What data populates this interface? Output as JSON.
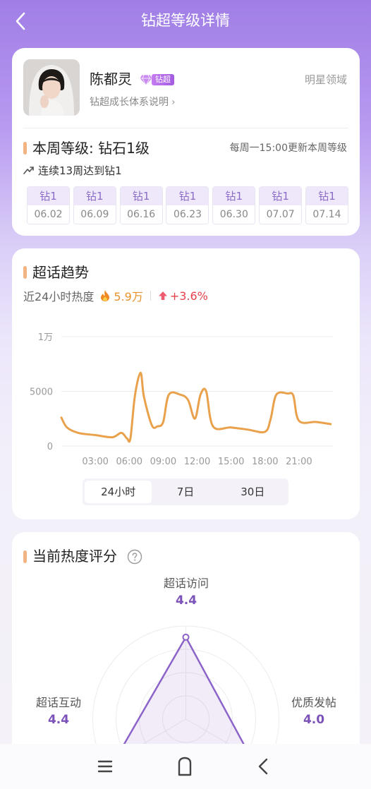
{
  "header": {
    "title": "钻超等级详情",
    "back_icon": "chevron-left-icon"
  },
  "profile": {
    "name": "陈都灵",
    "badge_label": "钻超",
    "growth_link": "钻超成长体系说明",
    "field": "明星领域"
  },
  "level": {
    "title": "本周等级: 钻石1级",
    "update_note": "每周一15:00更新本周等级",
    "streak": "连续13周达到钻1",
    "weeks": [
      {
        "level": "钻1",
        "date": "06.02"
      },
      {
        "level": "钻1",
        "date": "06.09"
      },
      {
        "level": "钻1",
        "date": "06.16"
      },
      {
        "level": "钻1",
        "date": "06.23"
      },
      {
        "level": "钻1",
        "date": "06.30"
      },
      {
        "level": "钻1",
        "date": "07.07"
      },
      {
        "level": "钻1",
        "date": "07.14"
      }
    ]
  },
  "trend": {
    "title": "超话趋势",
    "heat_label": "近24小时热度",
    "heat_value": "5.9万",
    "change": "+3.6%",
    "tabs": [
      "24小时",
      "7日",
      "30日"
    ],
    "active_tab": "24小时"
  },
  "chart_data": {
    "type": "line",
    "x_ticks": [
      "03:00",
      "06:00",
      "09:00",
      "12:00",
      "15:00",
      "18:00",
      "21:00"
    ],
    "y_ticks": [
      "0",
      "5000",
      "1万"
    ],
    "ylim": [
      0,
      10000
    ],
    "xlim": [
      0,
      24
    ],
    "grid": true,
    "series": [
      {
        "color": "#e9a14c",
        "x": [
          0,
          0.5,
          1.5,
          3,
          4.5,
          5.3,
          5.8,
          6.1,
          6.5,
          7,
          7.3,
          8,
          8.5,
          9,
          9.5,
          10.5,
          11.2,
          11.8,
          12.3,
          12.8,
          13.4,
          15,
          16.5,
          18,
          18.5,
          19,
          20,
          20.5,
          21,
          22.5,
          23.8
        ],
        "y": [
          2600,
          1700,
          1200,
          1000,
          800,
          1200,
          700,
          700,
          4600,
          6700,
          4500,
          1900,
          1800,
          2200,
          4700,
          4700,
          4200,
          2500,
          4700,
          5000,
          1800,
          1700,
          1500,
          1300,
          2500,
          4700,
          4800,
          4600,
          2300,
          2200,
          2000
        ]
      }
    ]
  },
  "rating": {
    "title": "当前热度评分",
    "help_icon": "question-circle-icon",
    "axes": [
      {
        "label": "超话访问",
        "value": "4.4"
      },
      {
        "label": "优质发帖",
        "value": "4.0"
      },
      {
        "label": "超话互动",
        "value": "4.4"
      }
    ],
    "max_score": 5,
    "color": "#8c64c9"
  },
  "navbar": {
    "menu_icon": "menu-icon",
    "home_icon": "home-icon",
    "back_icon": "back-icon"
  }
}
